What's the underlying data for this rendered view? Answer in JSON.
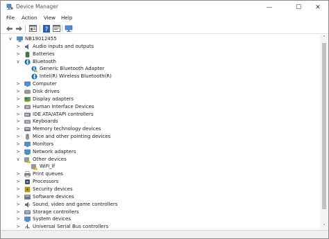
{
  "window": {
    "title": "Device Manager",
    "minimize_glyph": "—",
    "maximize_glyph": "☐",
    "close_glyph": "✕"
  },
  "menu": [
    "File",
    "Action",
    "View",
    "Help"
  ],
  "toolbar": [
    {
      "name": "back-icon"
    },
    {
      "name": "forward-icon"
    },
    {
      "name": "properties-icon"
    },
    {
      "name": "help-icon"
    },
    {
      "name": "update-driver-icon"
    },
    {
      "name": "scan-hardware-icon"
    }
  ],
  "tree": {
    "root": {
      "label": "NB19012455",
      "icon": "computer-icon",
      "chevron": "∨"
    },
    "items": [
      {
        "label": "Audio inputs and outputs",
        "icon": "speaker-icon",
        "chevron": ">",
        "level": 1
      },
      {
        "label": "Batteries",
        "icon": "battery-icon",
        "chevron": ">",
        "level": 1
      },
      {
        "label": "Bluetooth",
        "icon": "bluetooth-icon",
        "chevron": "∨",
        "level": 1
      },
      {
        "label": "Generic Bluetooth Adapter",
        "icon": "bluetooth-adapter-warning-icon",
        "chevron": "",
        "level": 2
      },
      {
        "label": "Intel(R) Wireless Bluetooth(R)",
        "icon": "bluetooth-icon",
        "chevron": "",
        "level": 2
      },
      {
        "label": "Computer",
        "icon": "monitor-icon",
        "chevron": ">",
        "level": 1
      },
      {
        "label": "Disk drives",
        "icon": "disk-drive-icon",
        "chevron": ">",
        "level": 1
      },
      {
        "label": "Display adapters",
        "icon": "display-adapter-icon",
        "chevron": ">",
        "level": 1
      },
      {
        "label": "Human Interface Devices",
        "icon": "hid-icon",
        "chevron": ">",
        "level": 1
      },
      {
        "label": "IDE ATA/ATAPI controllers",
        "icon": "ide-controller-icon",
        "chevron": ">",
        "level": 1
      },
      {
        "label": "Keyboards",
        "icon": "keyboard-icon",
        "chevron": ">",
        "level": 1
      },
      {
        "label": "Memory technology devices",
        "icon": "memory-icon",
        "chevron": ">",
        "level": 1
      },
      {
        "label": "Mice and other pointing devices",
        "icon": "mouse-icon",
        "chevron": ">",
        "level": 1
      },
      {
        "label": "Monitors",
        "icon": "monitor-icon",
        "chevron": ">",
        "level": 1
      },
      {
        "label": "Network adapters",
        "icon": "network-adapter-icon",
        "chevron": ">",
        "level": 1
      },
      {
        "label": "Other devices",
        "icon": "other-devices-icon",
        "chevron": "∨",
        "level": 1
      },
      {
        "label": "WiFi_lf",
        "icon": "unknown-device-warning-icon",
        "chevron": "",
        "level": 2
      },
      {
        "label": "Print queues",
        "icon": "printer-icon",
        "chevron": ">",
        "level": 1
      },
      {
        "label": "Processors",
        "icon": "processor-icon",
        "chevron": ">",
        "level": 1
      },
      {
        "label": "Security devices",
        "icon": "security-icon",
        "chevron": ">",
        "level": 1
      },
      {
        "label": "Software devices",
        "icon": "software-device-icon",
        "chevron": ">",
        "level": 1
      },
      {
        "label": "Sound, video and game controllers",
        "icon": "sound-icon",
        "chevron": ">",
        "level": 1
      },
      {
        "label": "Storage controllers",
        "icon": "storage-controller-icon",
        "chevron": ">",
        "level": 1
      },
      {
        "label": "System devices",
        "icon": "system-device-icon",
        "chevron": ">",
        "level": 1
      },
      {
        "label": "Universal Serial Bus controllers",
        "icon": "usb-icon",
        "chevron": ">",
        "level": 1
      }
    ]
  },
  "scrollbar": {
    "up_glyph": "˄",
    "down_glyph": "˅"
  },
  "colors": {
    "accent": "#2b7cd3",
    "warning": "#f2c200"
  }
}
